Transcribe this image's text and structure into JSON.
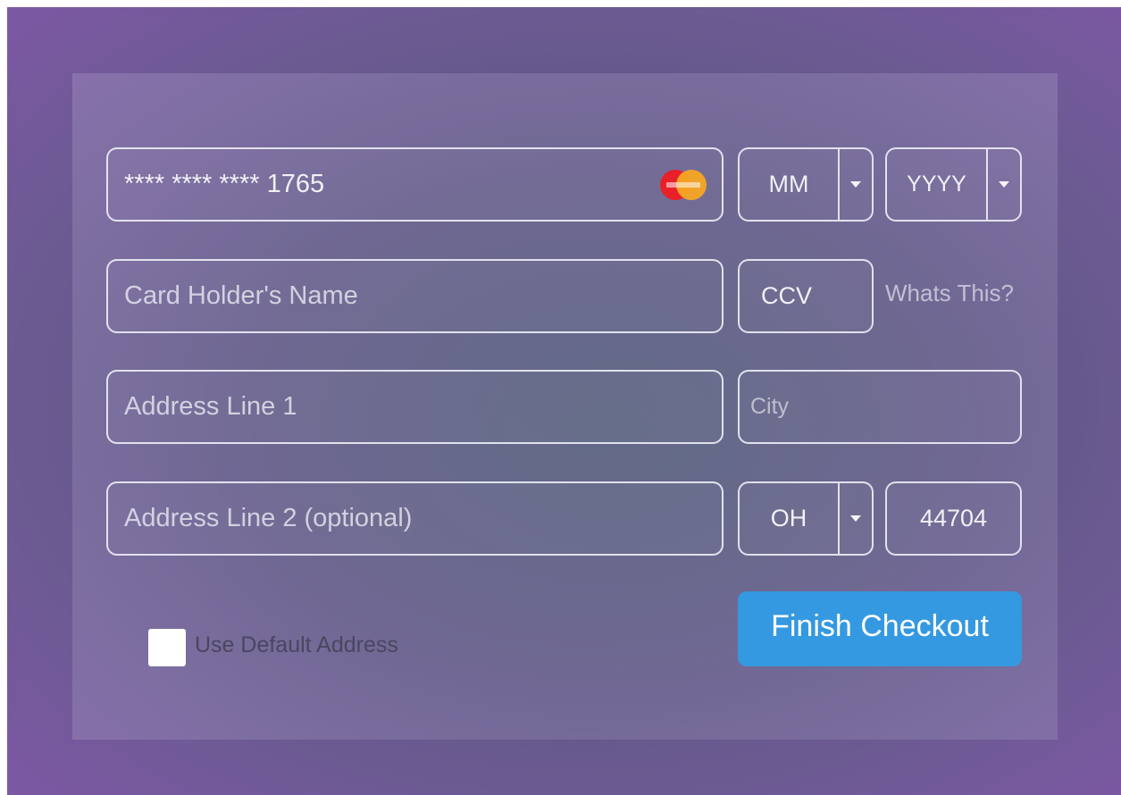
{
  "payment": {
    "card_number": "**** **** **** 1765",
    "card_brand_icon": "mastercard-icon",
    "exp_month": "MM",
    "exp_year": "YYYY",
    "card_holder_placeholder": "Card Holder's Name",
    "ccv_placeholder": "CCV",
    "whats_this_link": "Whats This?"
  },
  "address": {
    "line1_placeholder": "Address Line 1",
    "city_placeholder": "City",
    "line2_placeholder": "Address Line 2 (optional)",
    "state": "OH",
    "zip": "44704"
  },
  "options": {
    "use_default_label": "Use Default Address",
    "use_default_checked": false
  },
  "actions": {
    "finish_label": "Finish Checkout"
  },
  "colors": {
    "button": "#3499e0",
    "background": "#6b5a92"
  }
}
